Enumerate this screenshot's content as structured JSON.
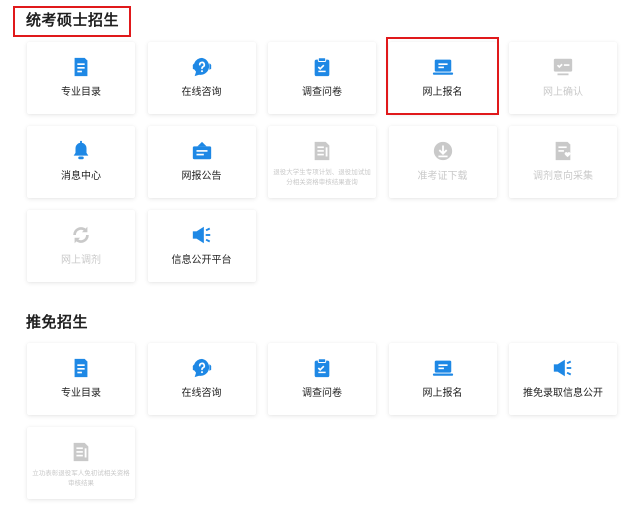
{
  "colors": {
    "accent": "#1e88e5",
    "disabled": "#c9c9c9",
    "highlight": "#e0191b"
  },
  "sections": [
    {
      "title": "统考硕士招生",
      "tiles": [
        {
          "label": "专业目录",
          "icon": "book-icon",
          "enabled": true
        },
        {
          "label": "在线咨询",
          "icon": "question-bubble-icon",
          "enabled": true
        },
        {
          "label": "调查问卷",
          "icon": "clipboard-check-icon",
          "enabled": true
        },
        {
          "label": "网上报名",
          "icon": "laptop-icon",
          "enabled": true
        },
        {
          "label": "网上确认",
          "icon": "monitor-check-icon",
          "enabled": false
        },
        {
          "label": "消息中心",
          "icon": "bell-icon",
          "enabled": true
        },
        {
          "label": "网报公告",
          "icon": "notice-board-icon",
          "enabled": true
        },
        {
          "label": "退役大学生专项计划、退役加试加分相关资格审核结果查询",
          "icon": "document-list-icon",
          "enabled": false
        },
        {
          "label": "准考证下载",
          "icon": "download-icon",
          "enabled": false
        },
        {
          "label": "调剂意向采集",
          "icon": "document-heart-icon",
          "enabled": false
        },
        {
          "label": "网上调剂",
          "icon": "refresh-icon",
          "enabled": false
        },
        {
          "label": "信息公开平台",
          "icon": "megaphone-icon",
          "enabled": true
        }
      ]
    },
    {
      "title": "推免招生",
      "tiles": [
        {
          "label": "专业目录",
          "icon": "book-icon",
          "enabled": true
        },
        {
          "label": "在线咨询",
          "icon": "question-bubble-icon",
          "enabled": true
        },
        {
          "label": "调查问卷",
          "icon": "clipboard-check-icon",
          "enabled": true
        },
        {
          "label": "网上报名",
          "icon": "laptop-icon",
          "enabled": true
        },
        {
          "label": "推免录取信息公开",
          "icon": "megaphone-icon",
          "enabled": true
        },
        {
          "label": "立功表彰退役军人免初试相关资格审核结果",
          "icon": "document-list-icon",
          "enabled": false
        }
      ]
    }
  ]
}
